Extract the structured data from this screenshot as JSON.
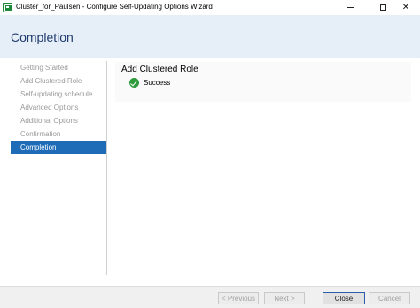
{
  "window": {
    "title": "Cluster_for_Paulsen - Configure Self-Updating Options Wizard",
    "controls": {
      "minimize": "minimize-icon",
      "maximize": "maximize-icon",
      "close": "close-icon"
    }
  },
  "header": {
    "title": "Completion"
  },
  "sidebar": {
    "items": [
      {
        "label": "Getting Started",
        "state": "disabled"
      },
      {
        "label": "Add Clustered Role",
        "state": "disabled"
      },
      {
        "label": "Self-updating schedule",
        "state": "disabled"
      },
      {
        "label": "Advanced Options",
        "state": "disabled"
      },
      {
        "label": "Additional Options",
        "state": "disabled"
      },
      {
        "label": "Confirmation",
        "state": "disabled"
      },
      {
        "label": "Completion",
        "state": "active"
      }
    ]
  },
  "main": {
    "heading": "Add Clustered Role",
    "status": {
      "icon": "success-check-icon",
      "text": "Success"
    }
  },
  "footer": {
    "previous_label": "< Previous",
    "next_label": "Next >",
    "close_label": "Close",
    "cancel_label": "Cancel"
  },
  "colors": {
    "header_bg": "#e6eef8",
    "title_color": "#1e3a6e",
    "active_nav_bg": "#1e6cb8",
    "success_green": "#2e9a3a",
    "app_icon_green": "#1e8a3a"
  }
}
